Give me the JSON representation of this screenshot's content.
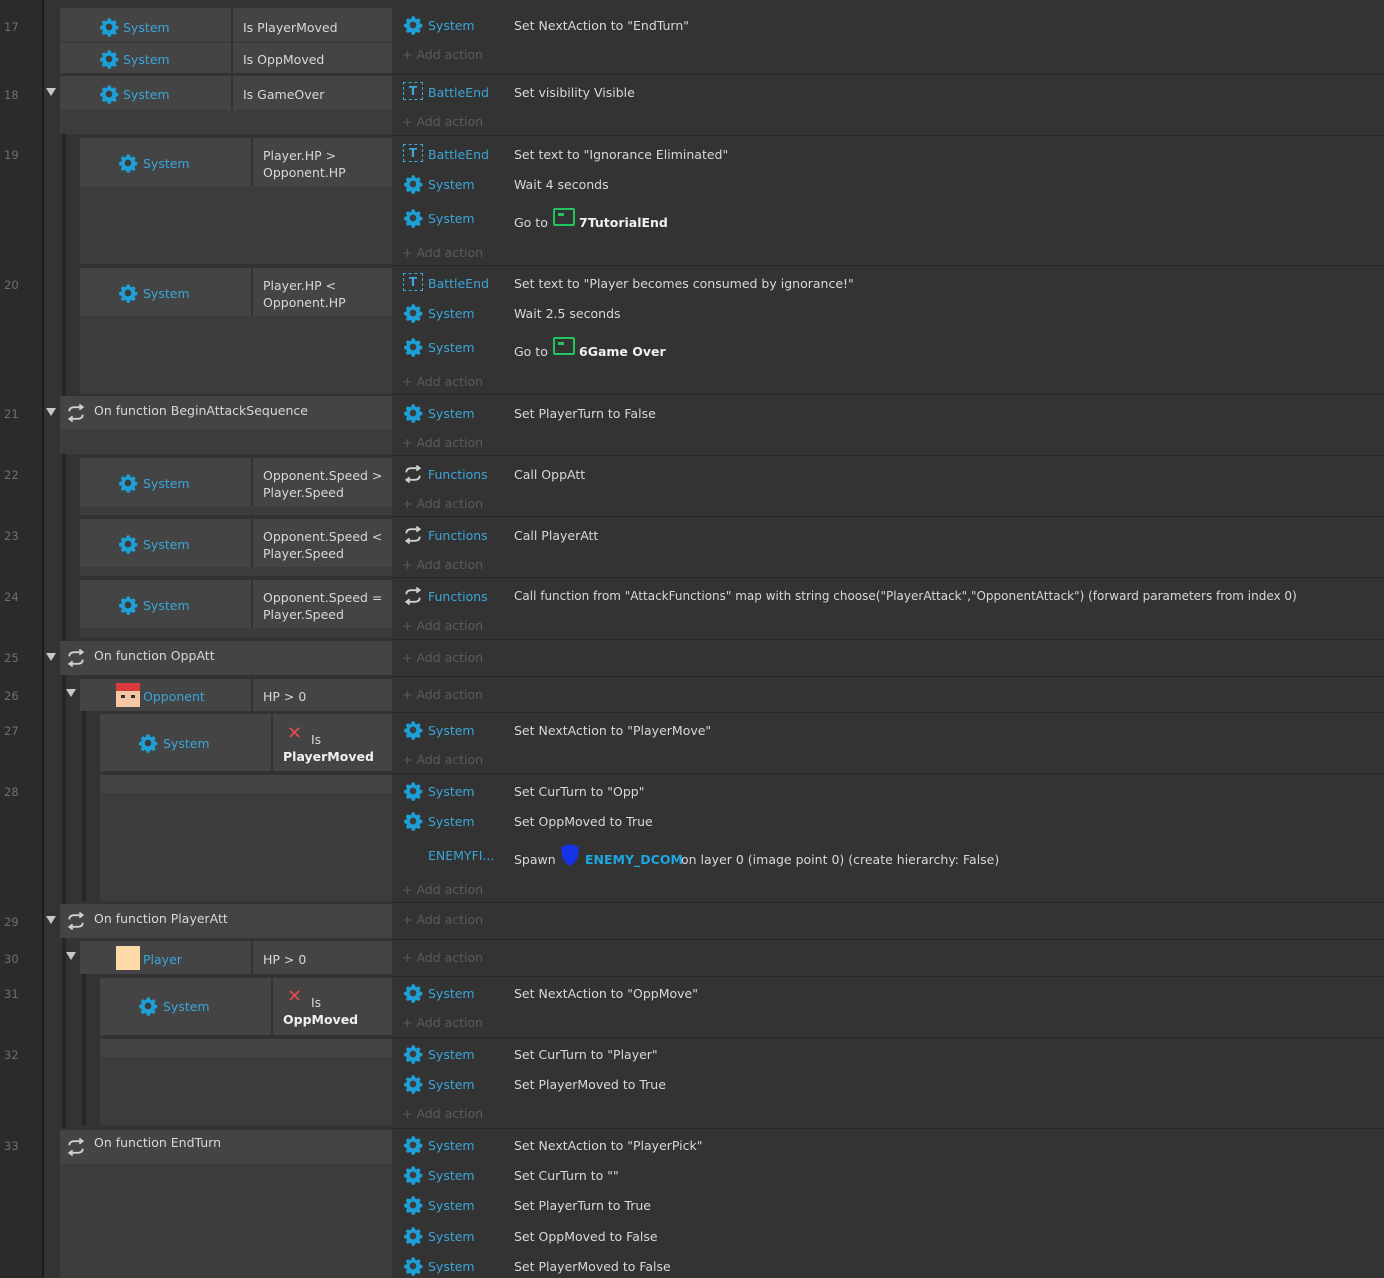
{
  "labels": {
    "system": "System",
    "battleend": "BattleEnd",
    "functions": "Functions",
    "opponent": "Opponent",
    "player": "Player",
    "enemyfi": "ENEMYFI...",
    "add_action": "Add action"
  },
  "line_numbers": [
    "17",
    "18",
    "19",
    "20",
    "21",
    "22",
    "23",
    "24",
    "25",
    "26",
    "27",
    "28",
    "29",
    "30",
    "31",
    "32",
    "33"
  ],
  "icons": {
    "system": "gear-icon",
    "battleend": "text-object-icon",
    "functions": "function-loop-icon",
    "goto": "layout-icon",
    "invert": "x-icon",
    "opponent": "opponent-sprite",
    "player": "player-sprite",
    "spawn": "enemy-shield-icon",
    "collapse": "triangle-down-icon"
  },
  "colors": {
    "accent": "#3aa6d9",
    "layout": "#22c55e",
    "invert": "#e54b4b",
    "gear": "#1e9fd6"
  },
  "rows": {
    "r17": {
      "c1": "Is PlayerMoved",
      "c2": "Is OppMoved",
      "a1": "Set NextAction to \"EndTurn\""
    },
    "r18": {
      "c1": "Is GameOver",
      "a1": "Set visibility Visible"
    },
    "r19": {
      "c1a": "Player.HP >",
      "c1b": "Opponent.HP",
      "a1": "Set text to \"Ignorance Eliminated\"",
      "a2": "Wait 4 seconds",
      "a3_pre": "Go to",
      "a3": "7TutorialEnd"
    },
    "r20": {
      "c1a": "Player.HP <",
      "c1b": "Opponent.HP",
      "a1": "Set text to \"Player becomes consumed by ignorance!\"",
      "a2": "Wait 2.5 seconds",
      "a3_pre": "Go to",
      "a3": "6Game Over"
    },
    "r21": {
      "fn": "On function BeginAttackSequence",
      "a1": "Set PlayerTurn to False"
    },
    "r22": {
      "c1a": "Opponent.Speed >",
      "c1b": "Player.Speed",
      "a1": "Call OppAtt"
    },
    "r23": {
      "c1a": "Opponent.Speed <",
      "c1b": "Player.Speed",
      "a1": "Call PlayerAtt"
    },
    "r24": {
      "c1a": "Opponent.Speed =",
      "c1b": "Player.Speed",
      "a1": "Call function from \"AttackFunctions\" map with string choose(\"PlayerAttack\",\"OpponentAttack\") (forward parameters from index 0)"
    },
    "r25": {
      "fn": "On function OppAtt"
    },
    "r26": {
      "c1": "HP > 0"
    },
    "r27": {
      "c1a": "Is",
      "c1b": "PlayerMoved",
      "a1": "Set NextAction to \"PlayerMove\""
    },
    "r28": {
      "a1": "Set CurTurn to \"Opp\"",
      "a2": "Set OppMoved to True",
      "a3_pre": "Spawn",
      "a3": "ENEMY_DCOM",
      "a3_post": "on layer 0 (image point 0) (create hierarchy: False)"
    },
    "r29": {
      "fn": "On function PlayerAtt"
    },
    "r30": {
      "c1": "HP > 0"
    },
    "r31": {
      "c1a": "Is",
      "c1b": "OppMoved",
      "a1": "Set NextAction to \"OppMove\""
    },
    "r32": {
      "a1": "Set CurTurn to \"Player\"",
      "a2": "Set PlayerMoved to True"
    },
    "r33": {
      "fn": "On function EndTurn",
      "a1": "Set NextAction to \"PlayerPick\"",
      "a2": "Set CurTurn to \"\"",
      "a3": "Set PlayerTurn to True",
      "a4": "Set OppMoved to False",
      "a5": "Set PlayerMoved to False"
    }
  }
}
